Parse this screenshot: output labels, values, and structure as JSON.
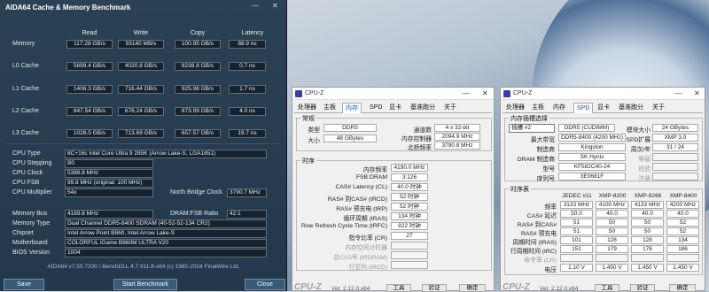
{
  "aida": {
    "title": "AIDA64 Cache & Memory Benchmark",
    "minimize": "—",
    "close": "✕",
    "headers": [
      "Read",
      "Write",
      "Copy",
      "Latency"
    ],
    "rows": [
      {
        "label": "Memory",
        "read": "117.28 GB/s",
        "write": "93140 MB/s",
        "copy": "100.95 GB/s",
        "latency": "88.9 ns"
      },
      {
        "label": "L0 Cache",
        "read": "5699.4 GB/s",
        "write": "4020.8 GB/s",
        "copy": "8238.8 GB/s",
        "latency": "0.7 ns"
      },
      {
        "label": "L1 Cache",
        "read": "1406.3 GB/s",
        "write": "716.44 GB/s",
        "copy": "925.98 GB/s",
        "latency": "1.7 ns"
      },
      {
        "label": "L2 Cache",
        "read": "847.54 GB/s",
        "write": "676.24 GB/s",
        "copy": "873.99 GB/s",
        "latency": "4.0 ns"
      },
      {
        "label": "L3 Cache",
        "read": "1028.5 GB/s",
        "write": "713.69 GB/s",
        "copy": "657.57 GB/s",
        "latency": "19.7 ns"
      }
    ],
    "info": {
      "cpu_type_label": "CPU Type",
      "cpu_type": "8C+16c Intel Core Ultra 9 285K  (Arrow Lake-S, LGA1851)",
      "cpu_stepping_label": "CPU Stepping",
      "cpu_stepping": "B0",
      "cpu_clock_label": "CPU Clock",
      "cpu_clock": "5386.8 MHz",
      "cpu_fsb_label": "CPU FSB",
      "cpu_fsb": "99.8 MHz  (original: 100 MHz)",
      "cpu_mult_label": "CPU Multiplier",
      "cpu_mult": "54x",
      "nb_clock_label": "North Bridge Clock",
      "nb_clock": "3790.7 MHz",
      "mem_bus_label": "Memory Bus",
      "mem_bus": "4189.8 MHz",
      "dram_ratio_label": "DRAM:FSB Ratio",
      "dram_ratio": "42:1",
      "mem_type_label": "Memory Type",
      "mem_type": "Dual Channel DDR5-8400 SDRAM  (40-52-52-134 CR2)",
      "chipset_label": "Chipset",
      "chipset": "Intel Arrow Point B860, Intel Arrow Lake-S",
      "mobo_label": "Motherboard",
      "mobo": "COLORFUL iGame B860M ULTRA V20",
      "bios_label": "BIOS Version",
      "bios": "1004"
    },
    "footer": "AIDA64 v7.50.7200 / BenchDLL 4.7.911.8-x64  (c) 1995-2024 FinalWire Ltd.",
    "save_label": "Save",
    "start_label": "Start Benchmark",
    "close_label": "Close"
  },
  "cpuz_mem": {
    "title": "CPU-Z",
    "tabs": [
      "处理器",
      "主板",
      "内存",
      "SPD",
      "显卡",
      "基准跑分",
      "关于"
    ],
    "general_title": "常规",
    "type_label": "类型",
    "type": "DDR5",
    "size_label": "大小",
    "size": "48 GBytes",
    "channel_label": "通道数",
    "channel": "4 x 32-bit",
    "mc_label": "内存控制器",
    "mc": "2094.9 MHz",
    "nb_label": "北桥频率",
    "nb": "3790.8 MHz",
    "timing_title": "时序",
    "timings": [
      {
        "label": "内存频率",
        "value": "4190.0 MHz"
      },
      {
        "label": "FSB:DRAM",
        "value": "3:126"
      },
      {
        "label": "CAS# Latency (CL)",
        "value": "40.0 时钟"
      },
      {
        "label": "RAS# 到CAS# (tRCD)",
        "value": "52 时钟"
      },
      {
        "label": "RAS# 预充电 (tRP)",
        "value": "52 时钟"
      },
      {
        "label": "循环周期 (tRAS)",
        "value": "134 时钟"
      },
      {
        "label": "Row Refresh Cycle Time (tRFC)",
        "value": "922 时钟"
      },
      {
        "label": "指令比率 (CR)",
        "value": "2T"
      },
      {
        "label": "内存空闲计时器",
        "value": ""
      },
      {
        "label": "总CAS号 (tRDRAM)",
        "value": ""
      },
      {
        "label": "行至列 (tRCD)",
        "value": ""
      }
    ],
    "footer_logo": "CPU-Z",
    "footer_ver": "Ver. 2.12.0.x64",
    "tools_label": "工具",
    "validate_label": "验证",
    "ok_label": "确定"
  },
  "cpuz_spd": {
    "title": "CPU-Z",
    "tabs": [
      "处理器",
      "主板",
      "内存",
      "SPD",
      "显卡",
      "基准跑分",
      "关于"
    ],
    "slot_title": "内存插槽选择",
    "slot": "插槽 #2",
    "slot_type": "DDR5 (CUDIMM)",
    "module_size_label": "模块大小",
    "module_size": "24 GBytes",
    "max_bw_label": "最大带宽",
    "max_bw": "DDR5-8400 (4200 MHz)",
    "spd_ext_label": "SPD扩展",
    "spd_ext": "XMP 3.0",
    "manuf_label": "制造商",
    "manuf": "Kingston",
    "week_label": "周次/年",
    "week": "31 / 24",
    "dram_manuf_label": "DRAM 制造商",
    "dram_manuf": "SK Hynix",
    "rank_label": "等级",
    "rank": "",
    "part_label": "型号",
    "part": "KF582C40-24",
    "reg_label": "校验",
    "reg": "",
    "serial_label": "序列号",
    "serial": "3E0681F",
    "buffer_label": "注册",
    "buffer": "",
    "timing_title": "时序表",
    "cols": [
      "JEDEC #11",
      "XMP-8200",
      "XMP-8266",
      "XMP-8400"
    ],
    "rows": [
      {
        "label": "频率",
        "vals": [
          "3133 MHz",
          "4100 MHz",
          "4133 MHz",
          "4200 MHz"
        ]
      },
      {
        "label": "CAS# 延迟",
        "vals": [
          "50.0",
          "40.0",
          "40.0",
          "40.0"
        ]
      },
      {
        "label": "RAS# 到CAS#",
        "vals": [
          "51",
          "50",
          "50",
          "52"
        ]
      },
      {
        "label": "RAS# 预充电",
        "vals": [
          "51",
          "50",
          "50",
          "52"
        ]
      },
      {
        "label": "周期时间 (tRAS)",
        "vals": [
          "101",
          "128",
          "128",
          "134"
        ]
      },
      {
        "label": "行周期时间 (tRC)",
        "vals": [
          "151",
          "179",
          "176",
          "186"
        ]
      },
      {
        "label": "命令率 (CR)",
        "vals": [
          "",
          "",
          "",
          ""
        ]
      },
      {
        "label": "电压",
        "vals": [
          "1.10 V",
          "1.450 V",
          "1.450 V",
          "1.450 V"
        ]
      }
    ],
    "footer_logo": "CPU-Z",
    "footer_ver": "Ver. 2.12.0.x64",
    "tools_label": "工具",
    "validate_label": "验证",
    "ok_label": "确定"
  }
}
